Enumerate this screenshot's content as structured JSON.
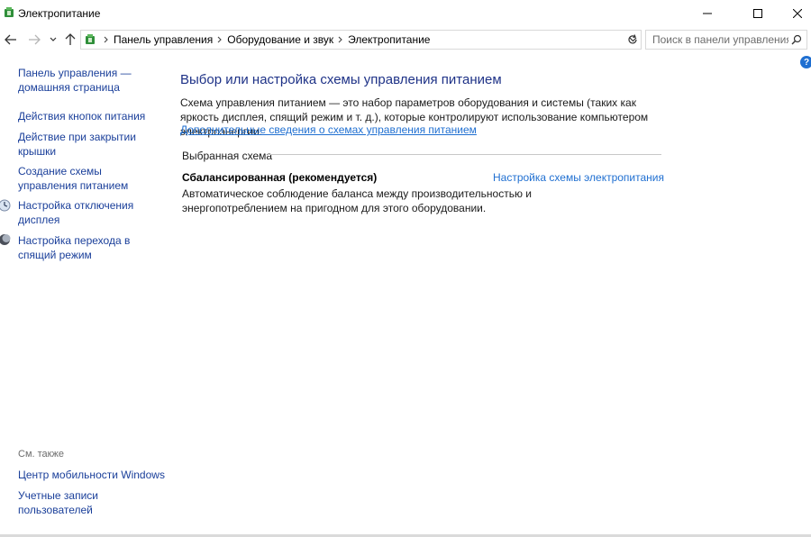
{
  "window": {
    "title": "Электропитание",
    "icon": "power-options-icon"
  },
  "address": {
    "crumbs": [
      "Панель управления",
      "Оборудование и звук",
      "Электропитание"
    ],
    "search_placeholder": "Поиск в панели управления"
  },
  "sidebar": {
    "home_link": "Панель управления — домашняя страница",
    "items": [
      {
        "label": "Действия кнопок питания",
        "icon": ""
      },
      {
        "label": "Действие при закрытии крышки",
        "icon": ""
      },
      {
        "label": "Создание схемы управления питанием",
        "icon": ""
      },
      {
        "label": "Настройка отключения дисплея",
        "icon": "display-shield-icon"
      },
      {
        "label": "Настройка перехода в спящий режим",
        "icon": "sleep-moon-icon"
      }
    ],
    "see_also_label": "См. также",
    "see_also": [
      {
        "label": "Центр мобильности Windows"
      },
      {
        "label": "Учетные записи пользователей"
      }
    ]
  },
  "main": {
    "title": "Выбор или настройка схемы управления питанием",
    "description": "Схема управления питанием — это набор параметров оборудования и системы (таких как яркость дисплея, спящий режим и т. д.), которые контролируют использование компьютером электроэнергии.",
    "more_link": "Дополнительные сведения о схемах управления питанием",
    "section_label": "Выбранная схема",
    "plan": {
      "name": "Сбалансированная (рекомендуется)",
      "settings_link": "Настройка схемы электропитания",
      "description": "Автоматическое соблюдение баланса между производительностью и энергопотреблением на пригодном для этого оборудовании."
    }
  },
  "colors": {
    "link": "#1f6fd1",
    "nav_link": "#1a3f9a",
    "title": "#1e3287"
  }
}
